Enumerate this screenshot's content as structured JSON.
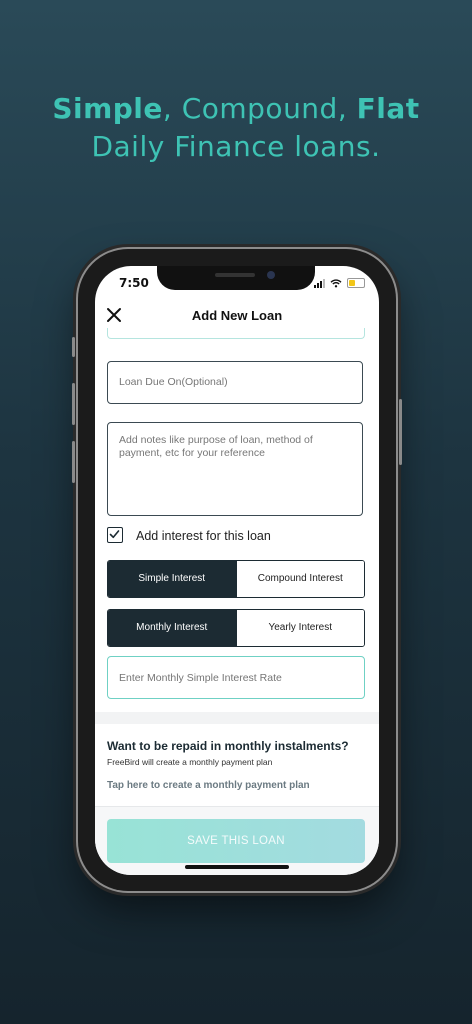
{
  "headline": {
    "word1": "Simple",
    "sep1": ", ",
    "word2": "Compound",
    "sep2": ", ",
    "word3": "Flat",
    "line2": "Daily Finance loans."
  },
  "status": {
    "time": "7:50"
  },
  "header": {
    "title": "Add New Loan"
  },
  "form": {
    "due_placeholder": "Loan Due On(Optional)",
    "notes_placeholder": "Add notes like purpose of loan, method of payment, etc for your reference",
    "interest_checkbox_label": "Add interest for this loan",
    "interest_checked": true,
    "interest_type": {
      "selected": "Simple Interest",
      "other": "Compound Interest"
    },
    "period": {
      "selected": "Monthly Interest",
      "other": "Yearly Interest"
    },
    "rate_placeholder": "Enter Monthly Simple Interest Rate"
  },
  "repay": {
    "title": "Want to be repaid in monthly instalments?",
    "subtitle": "FreeBird will create a monthly payment plan",
    "link": "Tap here to create a monthly payment plan"
  },
  "footer": {
    "save_label": "SAVE THIS LOAN"
  },
  "colors": {
    "accent": "#3ec3b4",
    "dark": "#1c2b33",
    "battery": "#f2c618"
  }
}
